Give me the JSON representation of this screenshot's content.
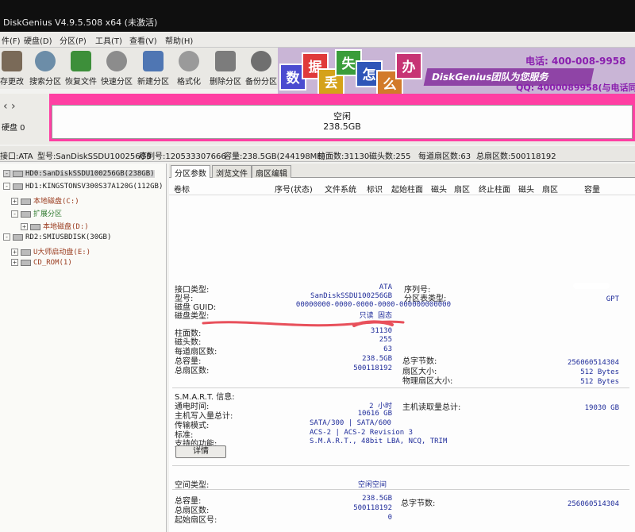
{
  "window": {
    "title": "DiskGenius V4.9.5.508 x64 (未激活)"
  },
  "menu": [
    "件(F)",
    "硬盘(D)",
    "分区(P)",
    "工具(T)",
    "查看(V)",
    "帮助(H)"
  ],
  "toolbar": [
    {
      "label": "存更改",
      "icon": "save-icon",
      "color": "#7a6a58"
    },
    {
      "label": "搜索分区",
      "icon": "search-icon",
      "color": "#6c8da8"
    },
    {
      "label": "恢复文件",
      "icon": "recover-icon",
      "color": "#3d8f3a"
    },
    {
      "label": "快速分区",
      "icon": "quick-partition-icon",
      "color": "#8c8c8c"
    },
    {
      "label": "新建分区",
      "icon": "new-partition-icon",
      "color": "#4f76b3"
    },
    {
      "label": "格式化",
      "icon": "format-icon",
      "color": "#9a9a9a"
    },
    {
      "label": "删除分区",
      "icon": "delete-icon",
      "color": "#7c7c7c"
    },
    {
      "label": "备份分区",
      "icon": "backup-icon",
      "color": "#6f6f6f"
    }
  ],
  "banner": {
    "tiles": [
      "数",
      "据",
      "丢",
      "失",
      "怎",
      "么",
      "办"
    ],
    "slogan": "DiskGenius团队为您服务",
    "phone": "电话: 400-008-9958",
    "qq": "QQ: 4000089958(与电话同号)",
    "accent": "#8f44a6"
  },
  "diskmap": {
    "disk_label": "硬盘 0",
    "partition_name": "空闲",
    "partition_size": "238.5GB",
    "border_color": "#ff3fa3"
  },
  "infostrip": {
    "interface": "接口:ATA",
    "model": "型号:SanDiskSSDU100256GB",
    "serial": "序列号:120533307666",
    "capacity": "容量:238.5GB(244198MB)",
    "cylinders": "柱面数:31130",
    "heads": "磁头数:255",
    "sectors_per_track": "每道扇区数:63",
    "total_sectors": "总扇区数:500118192"
  },
  "tree": [
    {
      "text": "HD0:SanDiskSSDU100256GB(238GB)",
      "kind": "disk"
    },
    {
      "text": "HD1:KINGSTONSV300S37A120G(112GB)",
      "kind": "disk"
    },
    {
      "text": "本地磁盘(C:)",
      "kind": "partition"
    },
    {
      "text": "扩展分区",
      "kind": "extended"
    },
    {
      "text": "本地磁盘(D:)",
      "kind": "partition"
    },
    {
      "text": "RD2:SMIUSBDISK(30GB)",
      "kind": "disk"
    },
    {
      "text": "U大师启动盘(E:)",
      "kind": "partition"
    },
    {
      "text": "CD_ROM(1)",
      "kind": "partition"
    }
  ],
  "tabs": [
    "分区参数",
    "浏览文件",
    "扇区编辑"
  ],
  "columns": [
    "卷标",
    "序号(状态)",
    "文件系统",
    "标识",
    "起始柱面",
    "磁头",
    "扇区",
    "终止柱面",
    "磁头",
    "扇区",
    "容量"
  ],
  "details": {
    "interface_type_label": "接口类型:",
    "interface_type": "ATA",
    "model_label": "型号:",
    "model": "SanDiskSSDU100256GB",
    "guid_label": "磁盘 GUID:",
    "guid": "00000000-0000-0000-0000-000000000000",
    "disk_type_label": "磁盘类型:",
    "disk_type": "只读  固态",
    "serial_label": "序列号:",
    "partition_table_label": "分区表类型:",
    "partition_table": "GPT",
    "cylinders_label": "柱面数:",
    "cylinders": "31130",
    "heads_label": "磁头数:",
    "heads": "255",
    "sectors_per_track_label": "每道扇区数:",
    "sectors_per_track": "63",
    "capacity_label": "总容量:",
    "capacity": "238.5GB",
    "total_sectors_label": "总扇区数:",
    "total_sectors": "500118192",
    "total_bytes_label": "总字节数:",
    "total_bytes": "256060514304",
    "sector_size_label": "扇区大小:",
    "sector_size": "512 Bytes",
    "physical_sector_label": "物理扇区大小:",
    "physical_sector": "512 Bytes"
  },
  "smart": {
    "title": "S.M.A.R.T. 信息:",
    "power_on_label": "通电时间:",
    "power_on": "2 小时",
    "host_writes_label": "主机写入量总计:",
    "host_writes": "10616 GB",
    "host_reads_label": "主机读取量总计:",
    "host_reads": "19030 GB",
    "transfer_label": "传输模式:",
    "transfer": "SATA/300 | SATA/600",
    "standard_label": "标准:",
    "standard": "ACS-2 | ACS-2 Revision 3",
    "features_label": "支持的功能:",
    "features": "S.M.A.R.T., 48bit LBA, NCQ, TRIM",
    "details_button": "详情"
  },
  "free": {
    "type_label": "空间类型:",
    "type": "空闲空间",
    "capacity_label": "总容量:",
    "capacity": "238.5GB",
    "total_bytes_label": "总字节数:",
    "total_bytes": "256060514304",
    "total_sectors_label": "总扇区数:",
    "total_sectors": "500118192",
    "start_sector_label": "起始扇区号:",
    "start_sector": "0"
  }
}
